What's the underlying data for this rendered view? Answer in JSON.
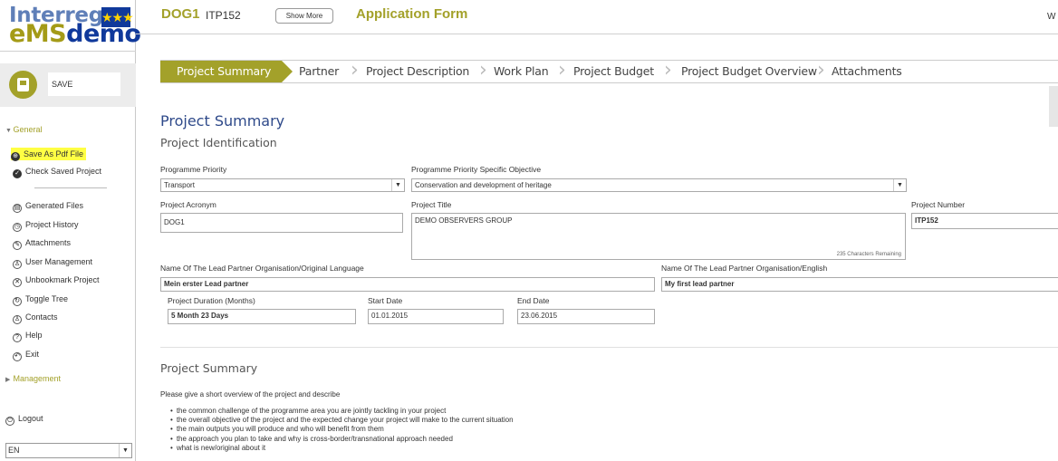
{
  "logo": {
    "line1": "Interreg",
    "line2a": "eMS",
    "line2b": "demo",
    "flag_stars": "★★★"
  },
  "sidebar": {
    "save_label": "SAVE",
    "general_label": "General",
    "items": [
      {
        "label": "Save As Pdf File"
      },
      {
        "label": "Check Saved Project"
      },
      {
        "label": "Generated Files"
      },
      {
        "label": "Project History"
      },
      {
        "label": "Attachments"
      },
      {
        "label": "User Management"
      },
      {
        "label": "Unbookmark Project"
      },
      {
        "label": "Toggle Tree"
      },
      {
        "label": "Contacts"
      },
      {
        "label": "Help"
      },
      {
        "label": "Exit"
      }
    ],
    "management_label": "Management",
    "logout_label": "Logout",
    "language": "EN"
  },
  "header": {
    "project_id": "DOG1",
    "itp": "ITP152",
    "show_more": "Show More",
    "title": "Application Form",
    "user_initial": "W"
  },
  "tabs": [
    {
      "label": "Project Summary"
    },
    {
      "label": "Partner"
    },
    {
      "label": "Project Description"
    },
    {
      "label": "Work Plan"
    },
    {
      "label": "Project Budget"
    },
    {
      "label": "Project Budget Overview"
    },
    {
      "label": "Attachments"
    }
  ],
  "form": {
    "heading": "Project Summary",
    "subheading": "Project Identification",
    "priority_label": "Programme Priority",
    "priority_value": "Transport",
    "objective_label": "Programme Priority Specific Objective",
    "objective_value": "Conservation and development of heritage",
    "acronym_label": "Project Acronym",
    "acronym_value": "DOG1",
    "title_label": "Project Title",
    "title_value": "DEMO OBSERVERS GROUP",
    "title_remaining": "235 Characters Remaining",
    "number_label": "Project Number",
    "number_value": "ITP152",
    "lead_orig_label": "Name Of The Lead Partner Organisation/Original Language",
    "lead_orig_value": "Mein erster Lead partner",
    "lead_en_label": "Name Of The Lead Partner Organisation/English",
    "lead_en_value": "My first lead partner",
    "duration_label": "Project Duration (Months)",
    "duration_value": "5 Month 23 Days",
    "start_label": "Start Date",
    "start_value": "01.01.2015",
    "end_label": "End Date",
    "end_value": "23.06.2015"
  },
  "summary": {
    "heading": "Project Summary",
    "intro": "Please give a short overview of the project and describe",
    "bullets": [
      "the common challenge of the programme area you are jointly tackling in your project",
      "the overall objective of the project and the expected change your project will make to the current situation",
      "the main outputs you will produce and who will benefit from them",
      "the approach you plan to take and why is cross-border/transnational approach needed",
      "what is new/original about it"
    ]
  }
}
